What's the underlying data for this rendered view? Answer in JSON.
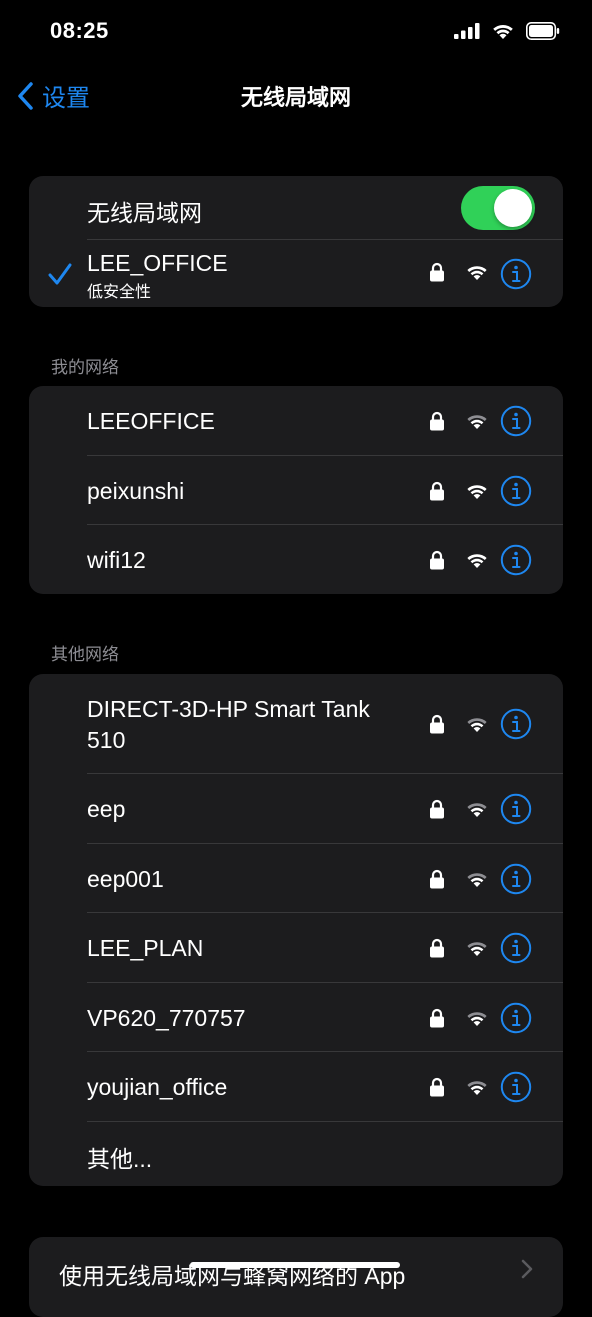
{
  "status_bar": {
    "time": "08:25"
  },
  "nav": {
    "back_label": "设置",
    "title": "无线局域网"
  },
  "wifi_toggle": {
    "label": "无线局域网",
    "enabled": true
  },
  "connected_network": {
    "name": "LEE_OFFICE",
    "subtitle": "低安全性"
  },
  "my_networks": {
    "header": "我的网络",
    "items": [
      {
        "name": "LEEOFFICE"
      },
      {
        "name": "peixunshi"
      },
      {
        "name": "wifi12"
      }
    ]
  },
  "other_networks": {
    "header": "其他网络",
    "items": [
      {
        "name": "DIRECT-3D-HP Smart Tank 510"
      },
      {
        "name": "eep"
      },
      {
        "name": "eep001"
      },
      {
        "name": "LEE_PLAN"
      },
      {
        "name": "VP620_770757"
      },
      {
        "name": "youjian_office"
      }
    ],
    "other_label": "其他..."
  },
  "bottom_row": {
    "label": "使用无线局域网与蜂窝网络的 App"
  },
  "colors": {
    "accent": "#1e87f0",
    "toggle_on": "#30d158",
    "group_bg": "#1c1c1e",
    "separator": "#38383a"
  }
}
